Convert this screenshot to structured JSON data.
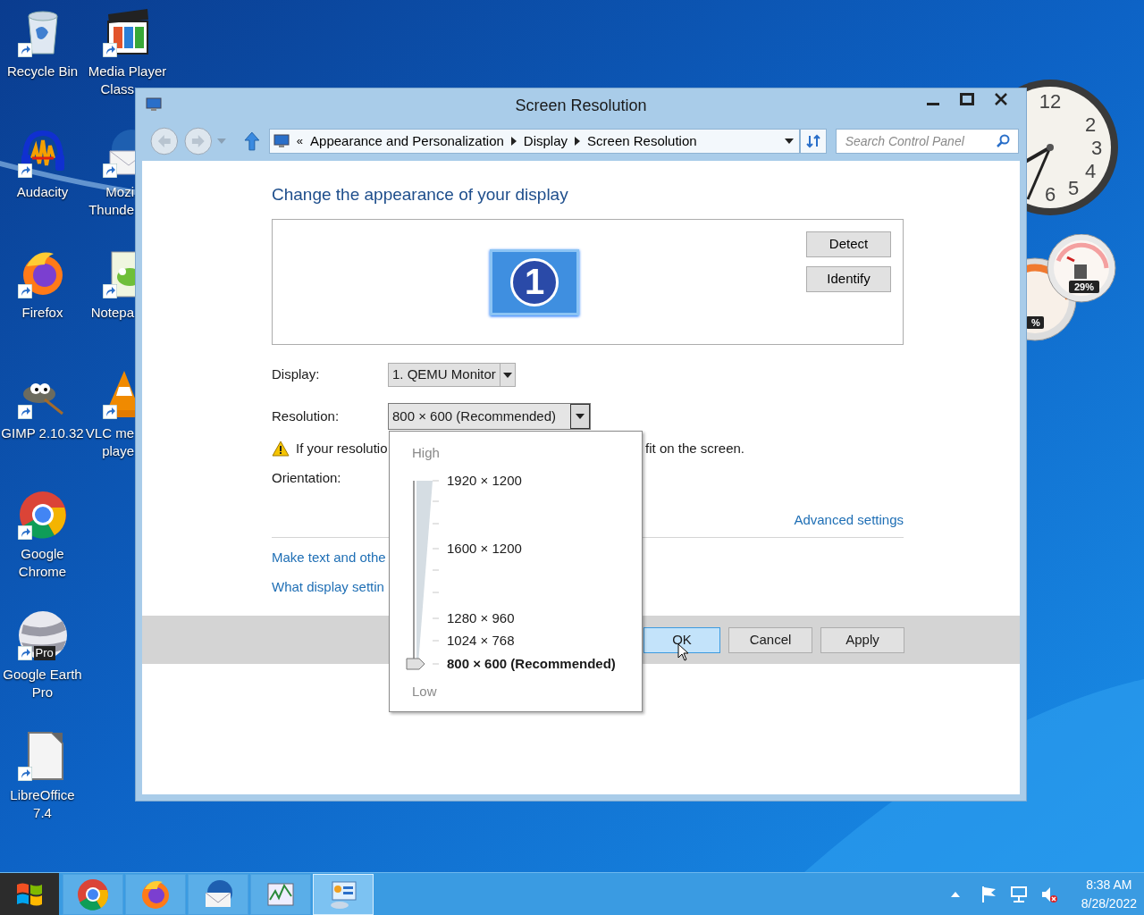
{
  "desktop_icons": [
    {
      "lines": [
        {
          "text": "Recycle Bin",
          "cut": false
        }
      ]
    },
    {
      "lines": [
        {
          "text": "Audacity",
          "cut": false
        }
      ]
    },
    {
      "lines": [
        {
          "text": "Firefox",
          "cut": false
        }
      ]
    },
    {
      "lines": [
        {
          "text": "GIMP 2.10.32",
          "cut": false
        }
      ]
    },
    {
      "lines": [
        {
          "text": "Google",
          "cut": false
        },
        {
          "text": "Chrome",
          "cut": false
        }
      ]
    },
    {
      "badge": "Pro",
      "lines": [
        {
          "text": "Google Earth",
          "cut": false
        },
        {
          "text": "Pro",
          "cut": false
        }
      ]
    },
    {
      "lines": [
        {
          "text": "LibreOffice",
          "cut": false
        },
        {
          "text": "7.4",
          "cut": false
        }
      ]
    },
    {
      "lines": [
        {
          "text": "Media Player",
          "cut": false
        },
        {
          "text": "Class",
          "cut": true
        }
      ]
    },
    {
      "lines": [
        {
          "text": "Mozi",
          "cut": true
        },
        {
          "text": "Thunde",
          "cut": true
        }
      ]
    },
    {
      "lines": [
        {
          "text": "Notepa",
          "cut": true
        }
      ]
    },
    {
      "lines": [
        {
          "text": "VLC me",
          "cut": true
        },
        {
          "text": "playe",
          "cut": true
        }
      ]
    }
  ],
  "gadgets": {
    "clock_numerals": [
      "12",
      "2",
      "3",
      "4",
      "5",
      "6"
    ],
    "meter_readings": [
      "29%",
      "%"
    ]
  },
  "window": {
    "title": "Screen Resolution",
    "nav": {
      "back_disabled": true,
      "forward_disabled": true
    },
    "address": {
      "overflow_mark": "«",
      "breadcrumbs": [
        "Appearance and Personalization",
        "Display",
        "Screen Resolution"
      ]
    },
    "search": {
      "placeholder": "Search Control Panel"
    },
    "heading": "Change the appearance of your display",
    "monitor_preview": {
      "number": "1"
    },
    "preview_buttons": [
      "Detect",
      "Identify"
    ],
    "fields": [
      {
        "label": "Display:",
        "value": "1. QEMU Monitor",
        "open": false
      },
      {
        "label": "Resolution:",
        "value": "800 × 600 (Recommended)",
        "open": true
      }
    ],
    "warning": {
      "text_before": "If your resolutio",
      "text_after": "fit on the screen."
    },
    "orientation_label": "Orientation:",
    "advanced_link": "Advanced settings",
    "links": [
      "Make text and othe",
      "What display settin"
    ],
    "buttons": [
      {
        "label": "OK",
        "focused": true
      },
      {
        "label": "Cancel",
        "focused": false
      },
      {
        "label": "Apply",
        "focused": false
      }
    ],
    "resolution_popup": {
      "high_label": "High",
      "low_label": "Low",
      "level": 0,
      "options": [
        {
          "label": "1920 × 1200",
          "selected": false
        },
        {
          "label": "1600 × 1200",
          "selected": false
        },
        {
          "label": "1280 × 960",
          "selected": false
        },
        {
          "label": "1024 × 768",
          "selected": false
        },
        {
          "label": "800 × 600 (Recommended)",
          "selected": true
        }
      ]
    }
  },
  "taskbar": {
    "apps": [
      {
        "active": false
      },
      {
        "active": false
      },
      {
        "active": false
      },
      {
        "active": false
      },
      {
        "active": true
      }
    ],
    "tray": {
      "time": "8:38 AM",
      "date": "8/28/2022"
    }
  }
}
